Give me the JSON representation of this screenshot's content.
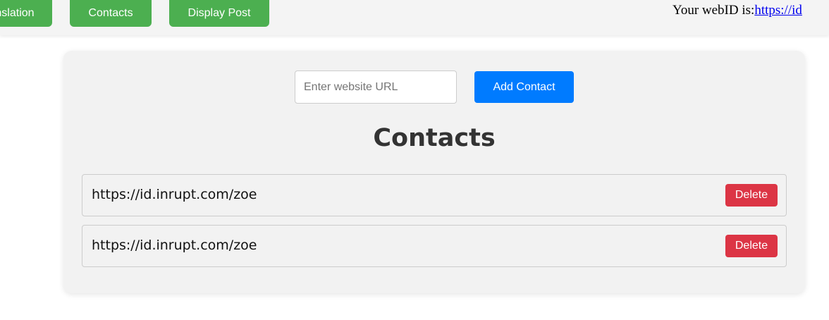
{
  "nav": {
    "translation_label": "Translation",
    "contacts_label": "Contacts",
    "display_post_label": "Display Post"
  },
  "webid": {
    "prefix": "Your webID is:",
    "link_text": "https://id"
  },
  "add_contact": {
    "input_placeholder": "Enter website URL",
    "input_value": "",
    "button_label": "Add Contact"
  },
  "contacts": {
    "title": "Contacts",
    "delete_label": "Delete",
    "items": [
      {
        "url": "https://id.inrupt.com/zoe"
      },
      {
        "url": "https://id.inrupt.com/zoe"
      }
    ]
  },
  "colors": {
    "nav_button": "#4caf50",
    "primary_button": "#007bff",
    "danger_button": "#dc3545",
    "link": "#0000ee"
  }
}
